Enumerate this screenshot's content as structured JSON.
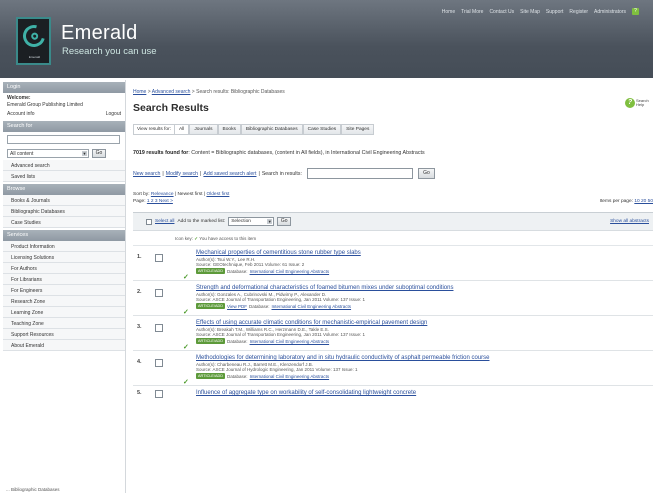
{
  "header": {
    "logo_small_text": "Emerald",
    "brand_name": "Emerald",
    "tagline": "Research you can use",
    "nav": [
      "Home",
      "Trial More",
      "Contact Us",
      "Site Map",
      "Support",
      "Register",
      "Administrators"
    ],
    "help_icon": "help-icon",
    "help_glyph": "?"
  },
  "sidebar": {
    "login_heading": "Login",
    "welcome_lines": [
      "Welcome:",
      "Emerald Group Publishing Limited"
    ],
    "account_info": "Account info",
    "logout": "Logout",
    "search_heading": "Search for",
    "scope_value": "All content",
    "go_label": "Go",
    "search_links": [
      "Advanced search",
      "Saved lists"
    ],
    "browse_heading": "Browse",
    "browse_links": [
      "Books & Journals",
      "Bibliographic Databases",
      "Case Studies"
    ],
    "resources_heading": "Services",
    "resources_links": [
      "Product Information",
      "Licensing Solutions",
      "For Authors",
      "For Librarians",
      "For Engineers",
      "Research Zone",
      "Learning Zone",
      "Teaching Zone",
      "Support Resources",
      "About Emerald"
    ],
    "bottom_text": "... Bibliographic Databases"
  },
  "main": {
    "breadcrumb": {
      "home": "Home",
      "sep": " > ",
      "advanced": "Advanced search",
      "current": " > Search results: Bibliographic Databases"
    },
    "title": "Search Results",
    "help_label": "Search Help",
    "tabs_label": "View results for:",
    "tabs": [
      "All",
      "Journals",
      "Books",
      "Bibliographic Databases",
      "Case Studies",
      "Site Pages"
    ],
    "results_count": "7019 results found for",
    "results_query": ": Content = Bibliographic databases, (content in All fields), in International Civil Engineering Abstracts",
    "actions": {
      "new_search": "New search",
      "modify": "Modify search",
      "add_alert": "Add saved search alert",
      "sep": " | ",
      "search_within_label": "Search in results:",
      "go": "Go"
    },
    "sort": {
      "label": "Sort by: ",
      "relevance": "Relevance",
      "newest": " | Newest first | ",
      "oldest": "Oldest first"
    },
    "paging": {
      "page_label": "Page: ",
      "pages": "1 2 3 Next >",
      "per_page_label": "Items per page: ",
      "per_page_values": "10 20 50"
    },
    "select_bar": {
      "select_all": "Select all",
      "add_label": "Add to the marked list:",
      "marked_value": "Selection",
      "go": "Go",
      "show_abstracts": "Show all abstracts"
    },
    "key": {
      "label": "Icon key:",
      "tick": "✓",
      "text": "You have access to this item"
    },
    "results": [
      {
        "num": "1.",
        "title": "Mechanical properties of cementitious stone rubber type slabs",
        "authors": "Author(s): Tsui W.Y., Lee R.H.",
        "source": "Source: GEOtechnique, Feb 2011 Volume: 61 Issue: 2",
        "pill": "ARTICLE/ADD",
        "db_label": "Database: ",
        "db": "International Civil Engineering Abstracts",
        "extra": ""
      },
      {
        "num": "2.",
        "title": "Strength and deformational characteristics of foamed bitumen mixes under suboptimal conditions",
        "authors": "Author(s): Gonzales A., Cubrinovski M., Pidwirny P., Alexander D.",
        "source": "Source: ASCE Journal of Transportation Engineering, Jan 2011 Volume: 137 Issue: 1",
        "pill": "ARTICLE/ADD",
        "db_label": "Database: ",
        "db": "International Civil Engineering Abstracts",
        "extra": "View PDF"
      },
      {
        "num": "3.",
        "title": "Effects of using accurate climatic conditions for mechanistic-empirical pavement design",
        "authors": "Author(s): Breakah T.M., Williams R.C., Herzmann D.E., Takle E.S.",
        "source": "Source: ASCE Journal of Transportation Engineering, Jan 2011 Volume: 137 Issue: 1",
        "pill": "ARTICLE/ADD",
        "db_label": "Database: ",
        "db": "International Civil Engineering Abstracts",
        "extra": ""
      },
      {
        "num": "4.",
        "title": "Methodologies for determining laboratory and in situ hydraulic conductivity of asphalt permeable friction course",
        "authors": "Author(s): Charbeneau R.J., Barrett M.E., Klenzendorf J.B.",
        "source": "Source: ASCE Journal of Hydrologic Engineering, Jan 2011 Volume: 137 Issue: 1",
        "pill": "ARTICLE/ADD",
        "db_label": "Database: ",
        "db": "International Civil Engineering Abstracts",
        "extra": ""
      },
      {
        "num": "5.",
        "title": "Influence of aggregate type on workability of self-consolidating lightweight concrete",
        "authors": "",
        "source": "",
        "pill": "",
        "db_label": "",
        "db": "",
        "extra": ""
      }
    ]
  },
  "colors": {
    "header_bg": "#4a525c",
    "brand_accent": "#3fb1a7",
    "link": "#2a4f9c",
    "access_green": "#4c9a2a"
  }
}
